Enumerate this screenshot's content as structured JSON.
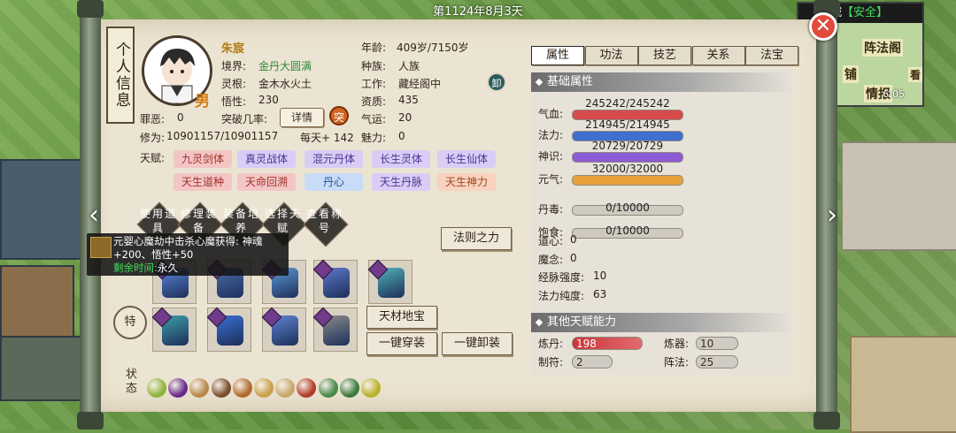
{
  "top": {
    "date": "第1124年8月3天"
  },
  "minimap": {
    "city": "城",
    "safe": "【安全】",
    "labels": [
      "阵法阁",
      "铺",
      "情报",
      "看"
    ],
    "time": "6:05"
  },
  "info_tab": "个人信息",
  "character": {
    "name": "朱宸",
    "gender": "男",
    "realm_label": "境界:",
    "realm": "金丹大圆满",
    "root_label": "灵根:",
    "root": "金木水火土",
    "comprehension_label": "悟性:",
    "comprehension": "230",
    "sin_label": "罪恶:",
    "sin": "0",
    "breakthrough_label": "突破几率:",
    "details_btn": "详情",
    "tu": "突",
    "cultivation_label": "修为:",
    "cultivation": "10901157/10901157",
    "daily": "每天+ 142",
    "age_label": "年龄:",
    "age": "409岁/7150岁",
    "race_label": "种族:",
    "race": "人族",
    "job_label": "工作:",
    "job": "藏经阁中",
    "xie": "卸",
    "aptitude_label": "资质:",
    "aptitude": "435",
    "luck_label": "气运:",
    "luck": "20",
    "charm_label": "魅力:",
    "charm": "0"
  },
  "talent_label": "天赋:",
  "talents": [
    {
      "label": "九灵剑体",
      "style": "pink"
    },
    {
      "label": "真灵战体",
      "style": "purple"
    },
    {
      "label": "混元丹体",
      "style": "purple"
    },
    {
      "label": "长生灵体",
      "style": "purple"
    },
    {
      "label": "长生仙体",
      "style": "purple"
    },
    {
      "label": "天生道种",
      "style": "pink"
    },
    {
      "label": "天命回溯",
      "style": "pink"
    },
    {
      "label": "丹心",
      "style": "blue"
    },
    {
      "label": "天生丹脉",
      "style": "purple"
    },
    {
      "label": "天生神力",
      "style": "orange"
    }
  ],
  "actions": [
    {
      "label": "使用道具"
    },
    {
      "label": "修理装备"
    },
    {
      "label": "装备培养"
    },
    {
      "label": "选择天赋"
    },
    {
      "label": "查看称号"
    }
  ],
  "law_btn": "法则之力",
  "tooltip": {
    "line1": "元婴心魔劫中击杀心魔获得: 神魂",
    "line2": "+200、悟性+50",
    "line3_label": "剩余时间:",
    "line3_value": "永久"
  },
  "side_char": "特",
  "buttons": {
    "treasure": "天材地宝",
    "equip_all": "一键穿装",
    "unequip_all": "一键卸装"
  },
  "status_label": "状态",
  "tabs": [
    {
      "label": "属性",
      "active": true
    },
    {
      "label": "功法",
      "active": false
    },
    {
      "label": "技艺",
      "active": false
    },
    {
      "label": "关系",
      "active": false
    },
    {
      "label": "法宝",
      "active": false
    }
  ],
  "basic_header": "基础属性",
  "bars": [
    {
      "label": "气血:",
      "text": "245242/245242",
      "fraction": 1.0,
      "color": "#d64b4b"
    },
    {
      "label": "法力:",
      "text": "214945/214945",
      "fraction": 1.0,
      "color": "#3f6fcf"
    },
    {
      "label": "神识:",
      "text": "20729/20729",
      "fraction": 1.0,
      "color": "#8c5bd6"
    },
    {
      "label": "元气:",
      "text": "32000/32000",
      "fraction": 1.0,
      "color": "#e8a03a"
    },
    {
      "label": "丹毒:",
      "text": "0/10000",
      "fraction": 0.0,
      "color": "#999999"
    },
    {
      "label": "饱食:",
      "text": "0/10000",
      "fraction": 0.0,
      "color": "#999999"
    }
  ],
  "plain_stats": [
    {
      "label": "道心:",
      "value": "0"
    },
    {
      "label": "魔念:",
      "value": "0"
    },
    {
      "label": "经脉强度:",
      "value": "10"
    },
    {
      "label": "法力纯度:",
      "value": "63"
    }
  ],
  "other_header": "其他天赋能力",
  "abilities": {
    "alchemy_label": "炼丹:",
    "alchemy": "198",
    "forge_label": "炼器:",
    "forge": "10",
    "talisman_label": "制符:",
    "talisman": "2",
    "formation_label": "阵法:",
    "formation": "25"
  }
}
